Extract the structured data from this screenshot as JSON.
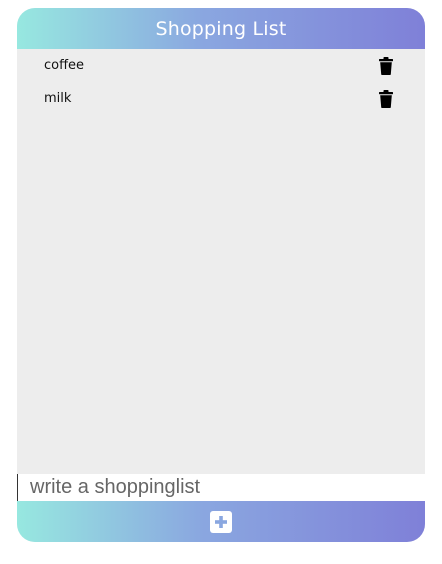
{
  "header": {
    "title": "Shopping List"
  },
  "list": {
    "items": [
      {
        "label": "coffee",
        "action_icon": "trash-icon"
      },
      {
        "label": "milk",
        "action_icon": "trash-icon"
      }
    ]
  },
  "input": {
    "placeholder": "write a shoppinglist",
    "value": ""
  },
  "footer": {
    "add_icon": "plus-icon"
  },
  "colors": {
    "gradient_start": "#97e8e0",
    "gradient_end": "#7f80d8",
    "list_background": "#ededed",
    "text": "#111111"
  }
}
